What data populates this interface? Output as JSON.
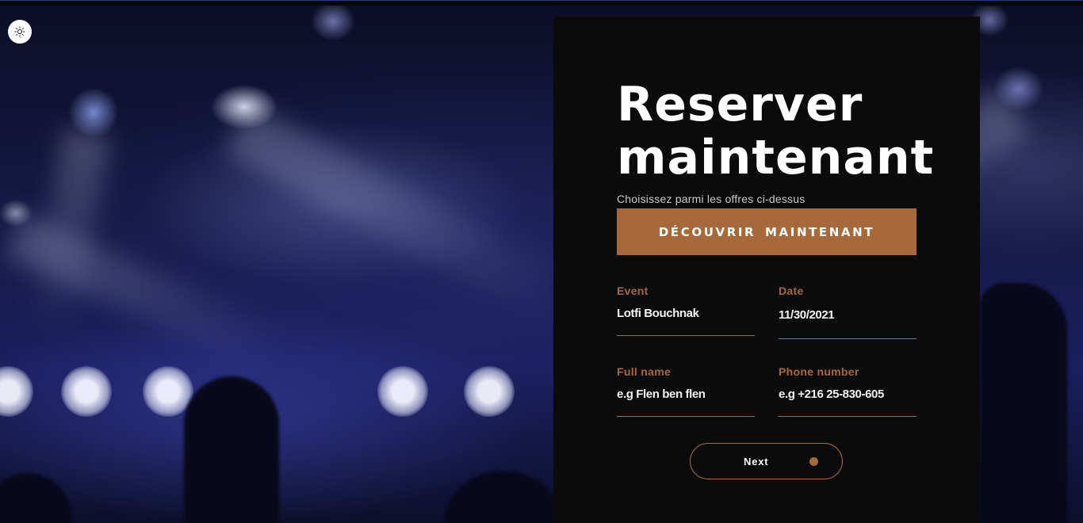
{
  "theme_toggle": {
    "icon": "sun-icon"
  },
  "booking": {
    "title_line1": "Reserver",
    "title_line2": "maintenant",
    "subtitle": "Choisissez parmi les offres ci-dessus",
    "cta_label": "DÉCOUVRIR  MAINTENANT",
    "fields": {
      "event": {
        "label": "Event",
        "value": "Lotfi Bouchnak"
      },
      "date": {
        "label": "Date",
        "value": "11/30/2021"
      },
      "full_name": {
        "label": "Full name",
        "placeholder": "e.g Flen ben flen"
      },
      "phone": {
        "label": "Phone number",
        "placeholder": "e.g +216 25-830-605"
      }
    },
    "next_label": "Next"
  },
  "colors": {
    "accent": "#a8693a",
    "panel": "#0b0b0b",
    "background": "#1a1f5e"
  }
}
